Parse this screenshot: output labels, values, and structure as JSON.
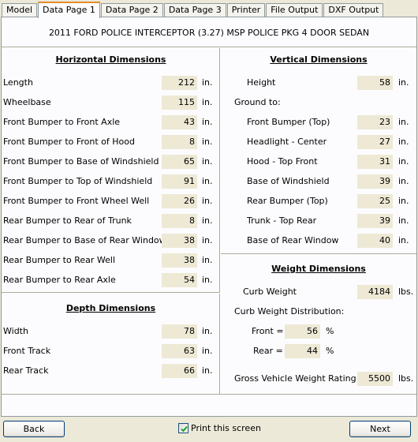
{
  "tabs": [
    "Model",
    "Data Page 1",
    "Data Page 2",
    "Data Page 3",
    "Printer",
    "File Output",
    "DXF Output"
  ],
  "vehicle_title": "2011 FORD POLICE INTERCEPTOR (3.27) MSP POLICE PKG 4 DOOR SEDAN",
  "horizontal": {
    "title": "Horizontal Dimensions",
    "rows": [
      {
        "label": "Length",
        "value": "212",
        "unit": "in."
      },
      {
        "label": "Wheelbase",
        "value": "115",
        "unit": "in."
      },
      {
        "label": "Front Bumper to Front Axle",
        "value": "43",
        "unit": "in."
      },
      {
        "label": "Front Bumper to Front of Hood",
        "value": "8",
        "unit": "in."
      },
      {
        "label": "Front Bumper to Base of Windshield",
        "value": "65",
        "unit": "in."
      },
      {
        "label": "Front Bumper to Top of Windshield",
        "value": "91",
        "unit": "in."
      },
      {
        "label": "Front Bumper to Front Wheel Well",
        "value": "26",
        "unit": "in."
      },
      {
        "label": "Rear Bumper to Rear of Trunk",
        "value": "8",
        "unit": "in."
      },
      {
        "label": "Rear Bumper to Base of Rear Window",
        "value": "38",
        "unit": "in."
      },
      {
        "label": "Rear Bumper to Rear Well",
        "value": "38",
        "unit": "in."
      },
      {
        "label": "Rear Bumper to Rear Axle",
        "value": "54",
        "unit": "in."
      }
    ]
  },
  "depth": {
    "title": "Depth Dimensions",
    "rows": [
      {
        "label": "Width",
        "value": "78",
        "unit": "in."
      },
      {
        "label": "Front Track",
        "value": "63",
        "unit": "in."
      },
      {
        "label": "Rear Track",
        "value": "66",
        "unit": "in."
      }
    ]
  },
  "vertical": {
    "title": "Vertical Dimensions",
    "height": {
      "label": "Height",
      "value": "58",
      "unit": "in."
    },
    "ground_to_label": "Ground to:",
    "rows": [
      {
        "label": "Front Bumper (Top)",
        "value": "23",
        "unit": "in."
      },
      {
        "label": "Headlight - Center",
        "value": "27",
        "unit": "in."
      },
      {
        "label": "Hood - Top Front",
        "value": "31",
        "unit": "in."
      },
      {
        "label": "Base of Windshield",
        "value": "39",
        "unit": "in."
      },
      {
        "label": "Rear Bumper (Top)",
        "value": "25",
        "unit": "in."
      },
      {
        "label": "Trunk - Top Rear",
        "value": "39",
        "unit": "in."
      },
      {
        "label": "Base of Rear Window",
        "value": "40",
        "unit": "in."
      }
    ]
  },
  "weight": {
    "title": "Weight Dimensions",
    "curb": {
      "label": "Curb Weight",
      "value": "4184",
      "unit": "lbs."
    },
    "distribution_label": "Curb Weight Distribution:",
    "front": {
      "label": "Front =",
      "value": "56",
      "unit": "%"
    },
    "rear": {
      "label": "Rear =",
      "value": "44",
      "unit": "%"
    },
    "gvwr": {
      "label": "Gross Vehicle Weight Rating",
      "value": "5500",
      "unit": "lbs."
    }
  },
  "footer": {
    "back": "Back",
    "print_label": "Print this screen",
    "print_checked": true,
    "next": "Next"
  }
}
